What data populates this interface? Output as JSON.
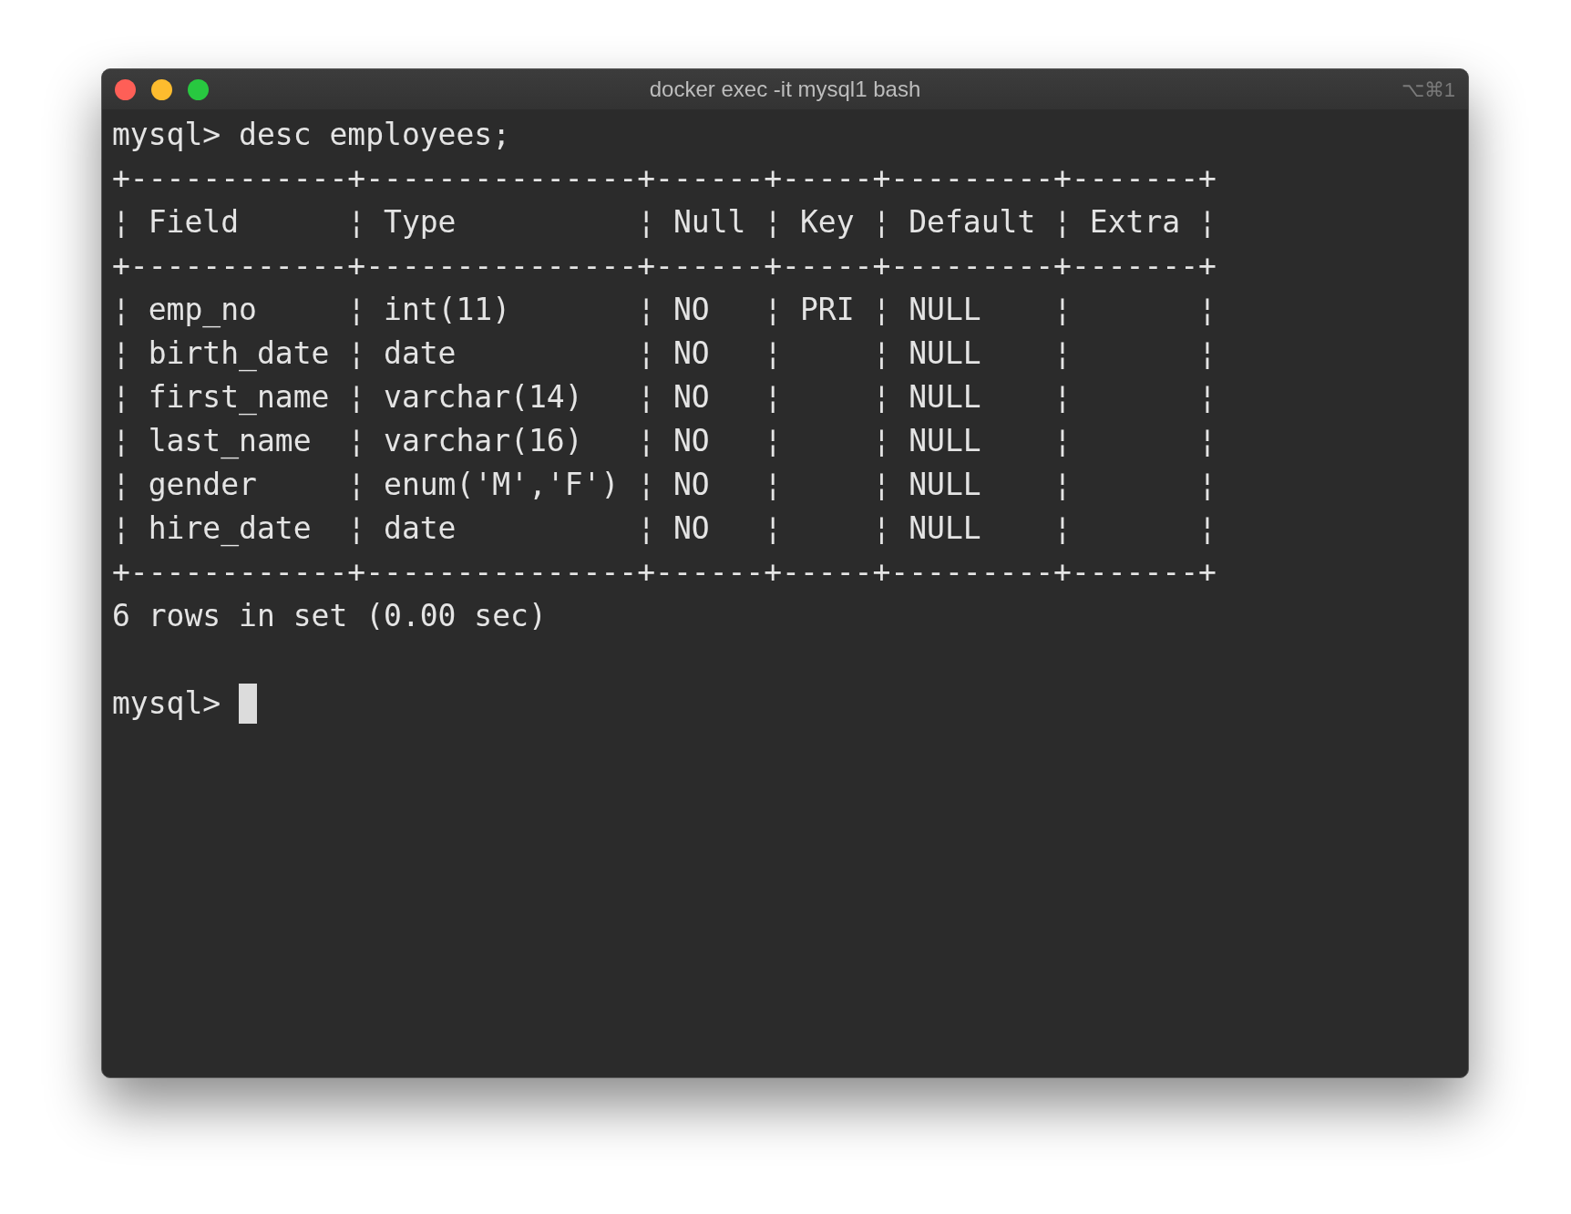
{
  "window": {
    "title": "docker exec -it mysql1 bash",
    "shortcut": "⌥⌘1"
  },
  "terminal": {
    "lines": [
      "mysql> desc employees;",
      "+------------+---------------+------+-----+---------+-------+",
      "¦ Field      ¦ Type          ¦ Null ¦ Key ¦ Default ¦ Extra ¦",
      "+------------+---------------+------+-----+---------+-------+",
      "¦ emp_no     ¦ int(11)       ¦ NO   ¦ PRI ¦ NULL    ¦       ¦",
      "¦ birth_date ¦ date          ¦ NO   ¦     ¦ NULL    ¦       ¦",
      "¦ first_name ¦ varchar(14)   ¦ NO   ¦     ¦ NULL    ¦       ¦",
      "¦ last_name  ¦ varchar(16)   ¦ NO   ¦     ¦ NULL    ¦       ¦",
      "¦ gender     ¦ enum('M','F') ¦ NO   ¦     ¦ NULL    ¦       ¦",
      "¦ hire_date  ¦ date          ¦ NO   ¦     ¦ NULL    ¦       ¦",
      "+------------+---------------+------+-----+---------+-------+",
      "6 rows in set (0.00 sec)"
    ],
    "prompt": "mysql>"
  }
}
